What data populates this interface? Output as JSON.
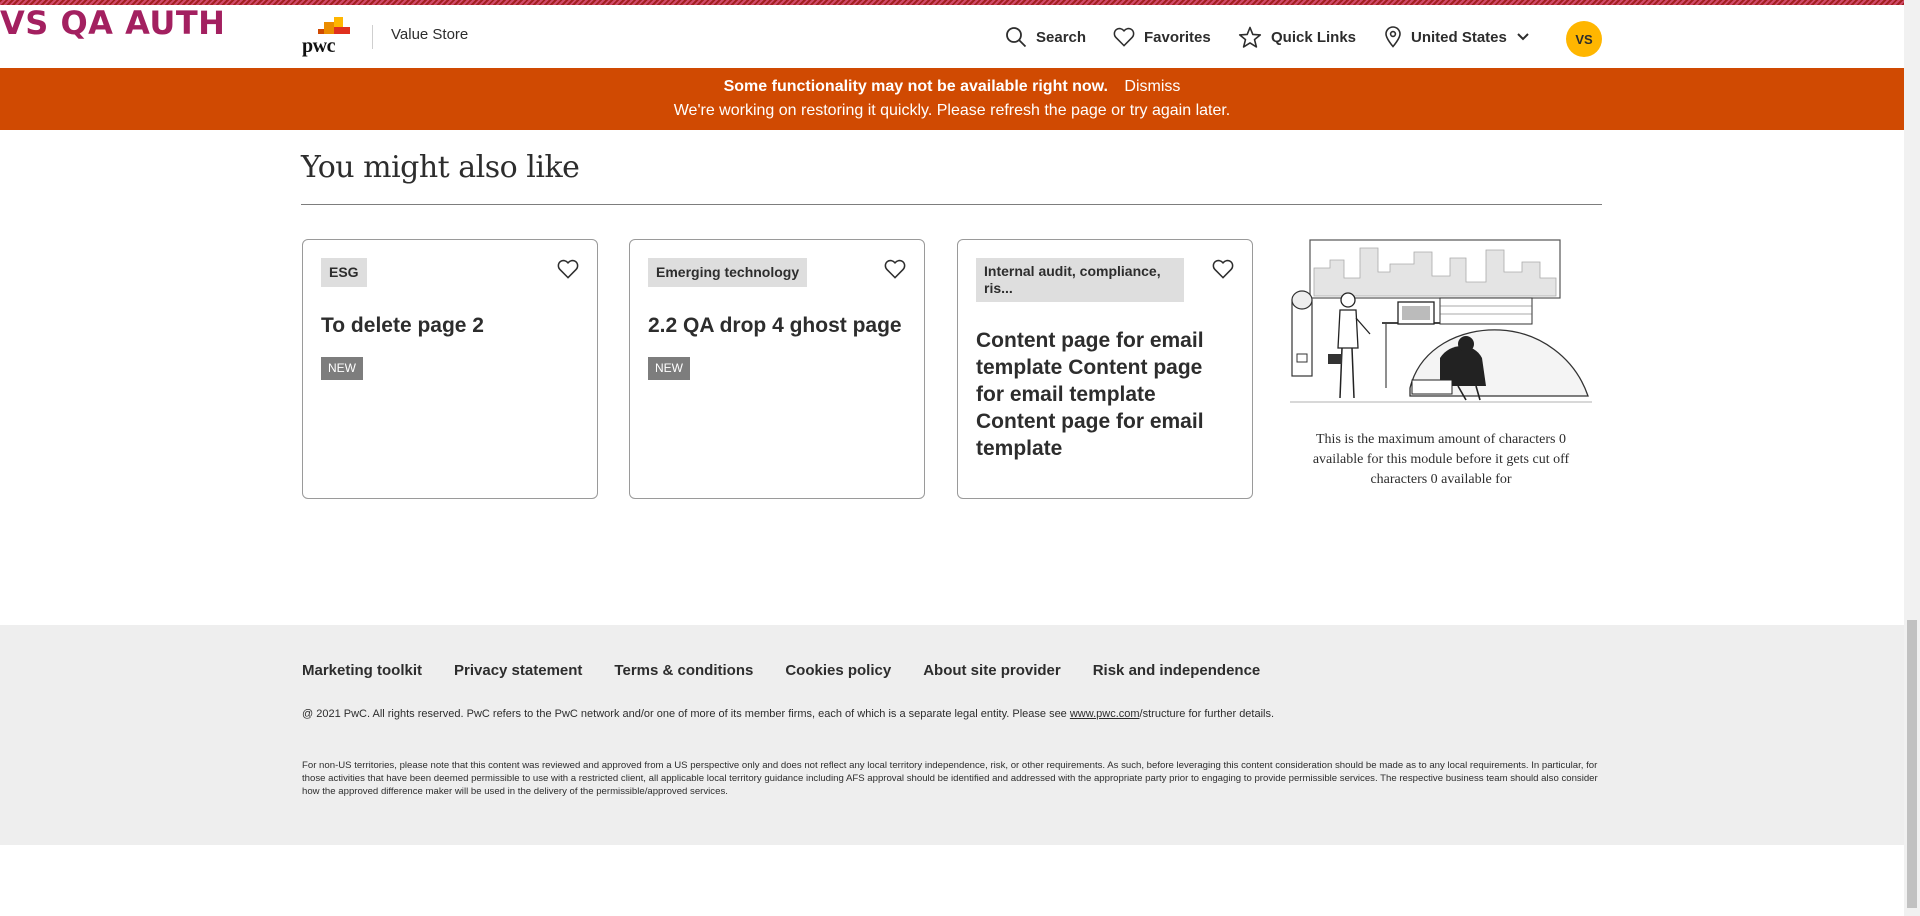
{
  "env_label": "VS QA AUTH",
  "header": {
    "logo_text": "pwc",
    "site_name": "Value Store",
    "nav": {
      "search": "Search",
      "favorites": "Favorites",
      "quick_links": "Quick Links",
      "location": "United States"
    },
    "avatar_initials": "VS"
  },
  "alert": {
    "title": "Some functionality may not be available right now.",
    "dismiss": "Dismiss",
    "message": "We're working on restoring it quickly. Please refresh the page or try again later."
  },
  "section": {
    "title": "You might also like"
  },
  "cards": [
    {
      "tag": "ESG",
      "title": "To delete page 2",
      "badge": "NEW"
    },
    {
      "tag": "Emerging technology",
      "title": "2.2 QA drop 4 ghost page",
      "badge": "NEW"
    },
    {
      "tag": "Internal audit, compliance, ris...",
      "title": "Content page for email template Content page for email template Content page for email template"
    }
  ],
  "promo": {
    "caption": "This is the maximum amount of characters 0 available for this module before it gets cut off characters 0 available for"
  },
  "footer": {
    "links": [
      "Marketing toolkit",
      "Privacy statement",
      "Terms & conditions",
      "Cookies policy",
      "About site provider",
      "Risk and independence"
    ],
    "copyright_pre": "@ 2021 PwC. All rights reserved. PwC refers to the PwC network and/or one of more of its member firms, each of which is a separate legal entity. Please see ",
    "copyright_link": "www.pwc.com",
    "copyright_post": "/structure for further details.",
    "disclaimer": "For non-US territories, please note that this content was reviewed and approved from a US perspective only and does not reflect any local territory independence, risk, or other requirements. As such, before leveraging this content consideration should be made as to any local requirements. In particular, for those activities that have been deemed permissible to use with a restricted client, all applicable local territory guidance including AFS approval should be identified and addressed with the appropriate party prior to engaging to provide permissible services. The respective business team should also consider how the approved difference maker will be used in the delivery of the permissible/approved services."
  },
  "colors": {
    "brand_orange": "#d04a02",
    "avatar_yellow": "#ffb600",
    "env_label": "#a32060"
  }
}
